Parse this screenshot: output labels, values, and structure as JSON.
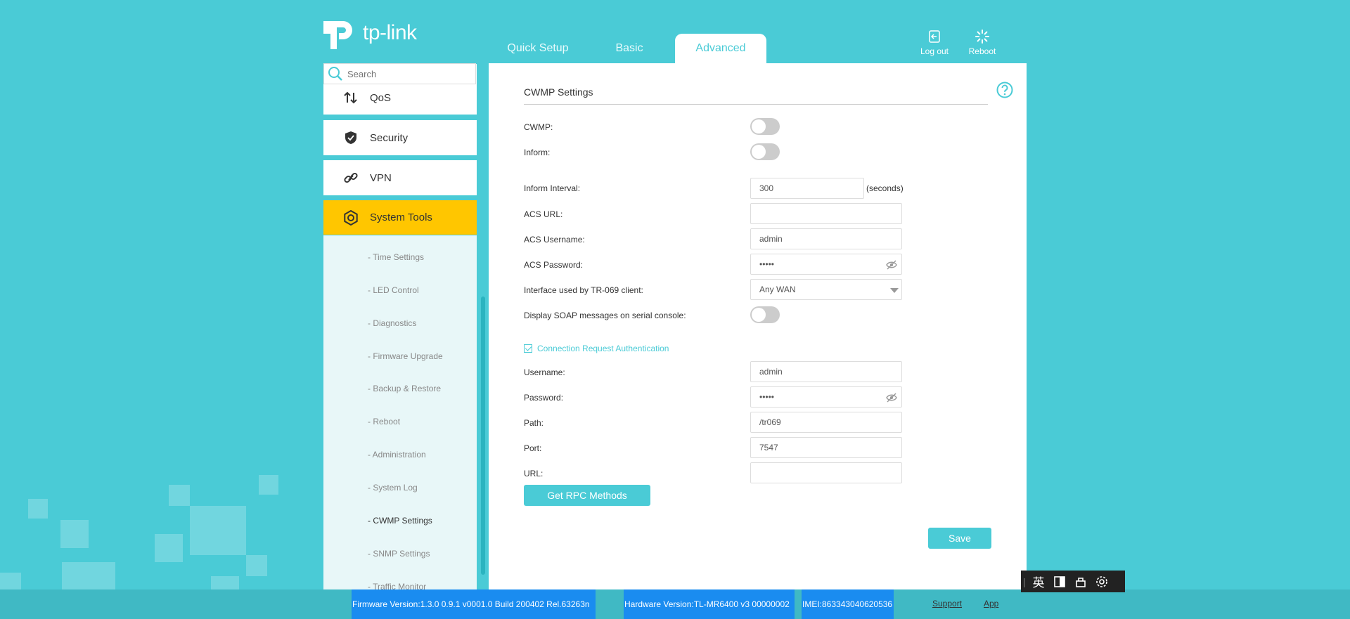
{
  "brand": {
    "logo_text": "tp-link"
  },
  "tabs": [
    {
      "label": "Quick Setup"
    },
    {
      "label": "Basic"
    },
    {
      "label": "Advanced"
    }
  ],
  "header_actions": {
    "logout": "Log out",
    "reboot": "Reboot"
  },
  "search": {
    "placeholder": "Search"
  },
  "sidebar": {
    "items": [
      {
        "label": "QoS",
        "icon": "qos-icon"
      },
      {
        "label": "Security",
        "icon": "shield-icon"
      },
      {
        "label": "VPN",
        "icon": "vpn-link-icon"
      },
      {
        "label": "System Tools",
        "icon": "system-tools-gear-icon"
      }
    ],
    "subitems": [
      {
        "label": "- Time Settings"
      },
      {
        "label": "- LED Control"
      },
      {
        "label": "- Diagnostics"
      },
      {
        "label": "- Firmware Upgrade"
      },
      {
        "label": "- Backup & Restore"
      },
      {
        "label": "- Reboot"
      },
      {
        "label": "- Administration"
      },
      {
        "label": "- System Log"
      },
      {
        "label": "- CWMP Settings"
      },
      {
        "label": "- SNMP Settings"
      },
      {
        "label": "- Traffic Monitor"
      }
    ]
  },
  "main": {
    "title": "CWMP Settings",
    "cwmp_label": "CWMP:",
    "inform_label": "Inform:",
    "inform_interval": {
      "label": "Inform Interval:",
      "value": "300",
      "unit": "(seconds)"
    },
    "acs_url": {
      "label": "ACS URL:",
      "value": ""
    },
    "acs_username": {
      "label": "ACS Username:",
      "value": "admin"
    },
    "acs_password": {
      "label": "ACS Password:",
      "value": "•••••"
    },
    "interface": {
      "label": "Interface used by TR-069 client:",
      "value": "Any WAN"
    },
    "soap_label": "Display SOAP messages on serial console:",
    "conn_auth_label": "Connection Request Authentication",
    "username": {
      "label": "Username:",
      "value": "admin"
    },
    "password": {
      "label": "Password:",
      "value": "•••••"
    },
    "path": {
      "label": "Path:",
      "value": "/tr069"
    },
    "port": {
      "label": "Port:",
      "value": "7547"
    },
    "url": {
      "label": "URL:",
      "value": ""
    },
    "get_rpc_button": "Get RPC Methods",
    "save_button": "Save"
  },
  "footer": {
    "firmware": "Firmware Version:1.3.0 0.9.1 v0001.0 Build 200402 Rel.63263n",
    "hardware": "Hardware Version:TL-MR6400 v3 00000002",
    "imei": "IMEI:863343040620536",
    "support": "Support",
    "app": "App"
  },
  "ime_toolbar": {
    "lang": "英"
  },
  "colors": {
    "accent": "#4acbd6",
    "active_menu": "#ffc600",
    "footer_highlight": "#1a8cf0"
  }
}
